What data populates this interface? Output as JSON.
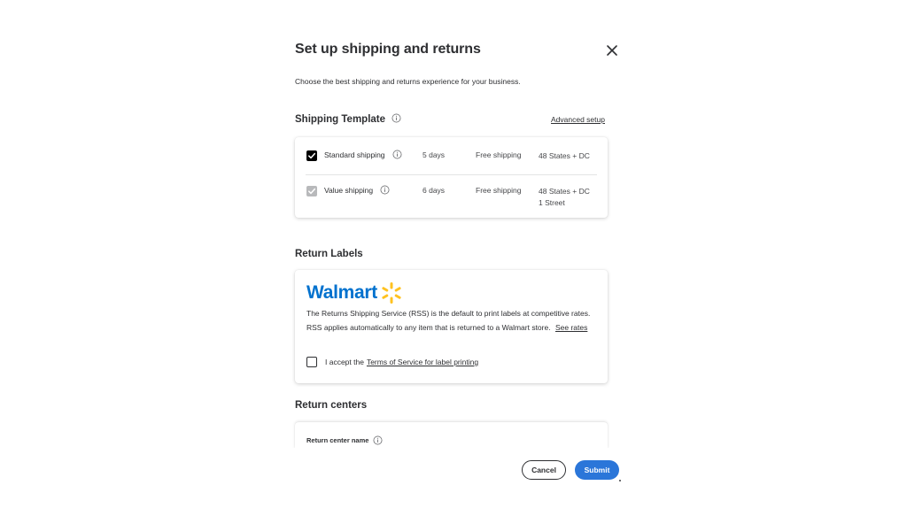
{
  "modal": {
    "title": "Set up shipping and returns",
    "subtitle": "Choose the best shipping and returns experience for your business."
  },
  "shipping": {
    "heading": "Shipping Template",
    "advanced_link": "Advanced setup",
    "rows": [
      {
        "name": "Standard shipping",
        "days": "5 days",
        "cost": "Free shipping",
        "area_line1": "48 States + DC",
        "area_line2": "",
        "checked": true,
        "disabled": false
      },
      {
        "name": "Value shipping",
        "days": "6 days",
        "cost": "Free shipping",
        "area_line1": "48 States + DC",
        "area_line2": "1 Street",
        "checked": true,
        "disabled": true
      }
    ]
  },
  "return_labels": {
    "heading": "Return Labels",
    "brand": "Walmart",
    "description": "The Returns Shipping Service (RSS) is the default to print labels at competitive rates. RSS applies automatically to any item that is returned to a Walmart store.",
    "see_rates": "See rates",
    "accept_prefix": "I accept the",
    "accept_link": "Terms of Service for label printing"
  },
  "return_centers": {
    "heading": "Return centers",
    "field_label": "Return center name"
  },
  "footer": {
    "cancel": "Cancel",
    "submit": "Submit"
  },
  "colors": {
    "brand_blue": "#0071ce",
    "spark_yellow": "#ffc220",
    "submit_blue": "#2b76d9",
    "text_dark": "#2e2f32"
  }
}
